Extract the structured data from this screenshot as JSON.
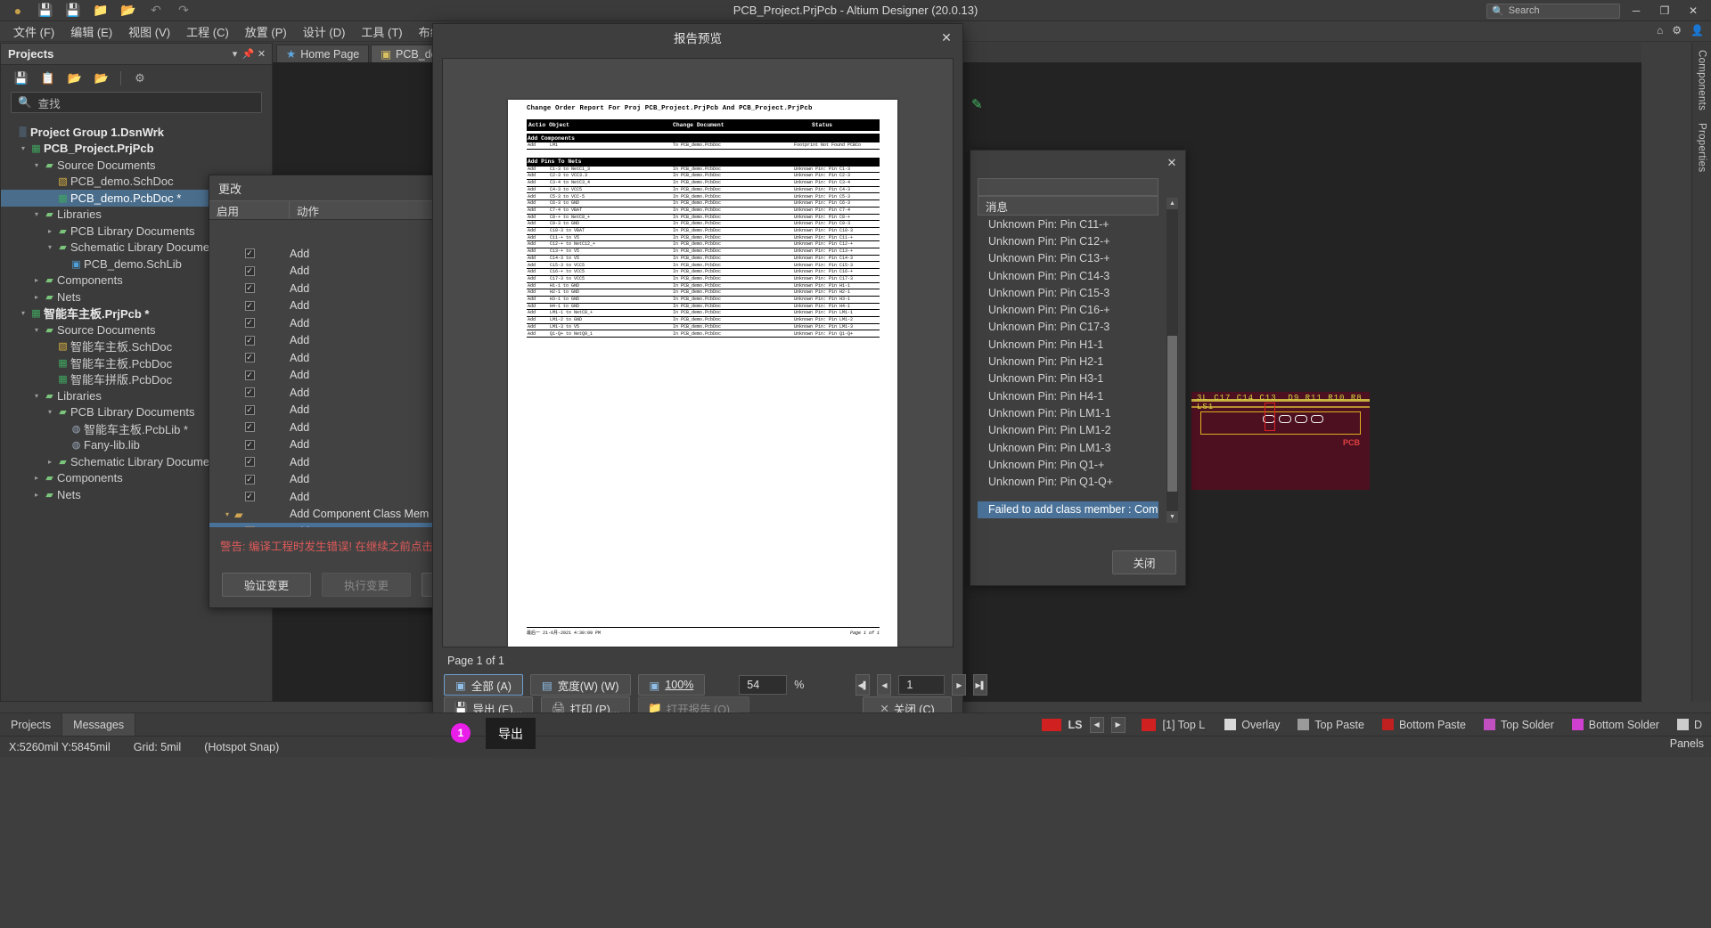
{
  "window": {
    "title": "PCB_Project.PrjPcb - Altium Designer (20.0.13)",
    "search_placeholder": "Search",
    "minimize": "─",
    "maximize": "❐",
    "close": "✕"
  },
  "toolbar_icons": [
    "altium-logo-icon",
    "save-icon",
    "save-all-icon",
    "open-folder-icon",
    "open-project-icon",
    "undo-icon",
    "redo-icon"
  ],
  "menubar": {
    "items": [
      {
        "label": "文件 (F)"
      },
      {
        "label": "编辑 (E)"
      },
      {
        "label": "视图 (V)"
      },
      {
        "label": "工程 (C)"
      },
      {
        "label": "放置 (P)"
      },
      {
        "label": "设计 (D)"
      },
      {
        "label": "工具 (T)"
      },
      {
        "label": "布线 (U)"
      },
      {
        "label": "报"
      }
    ],
    "right_icons": [
      "home-icon",
      "gear-icon",
      "user-icon"
    ]
  },
  "projects_panel": {
    "title": "Projects",
    "header_buttons": [
      "chevron-down-icon",
      "pin-icon",
      "close-icon"
    ],
    "toolbar_icons": [
      "save-icon",
      "compile-icon",
      "open-project-icon",
      "project-options-icon",
      "gear-icon"
    ],
    "search_placeholder": "查找",
    "tree": [
      {
        "label": "Project Group 1.DsnWrk",
        "depth": 0,
        "twist": "",
        "icon": "workspace-icon",
        "bold": true,
        "selected": false
      },
      {
        "label": "PCB_Project.PrjPcb",
        "depth": 1,
        "twist": "▾",
        "icon": "pcb-project-icon",
        "bold": true,
        "selected": false
      },
      {
        "label": "Source Documents",
        "depth": 2,
        "twist": "▾",
        "icon": "folder-icon",
        "bold": false,
        "selected": false
      },
      {
        "label": "PCB_demo.SchDoc",
        "depth": 3,
        "twist": "",
        "icon": "schdoc-icon",
        "bold": false,
        "selected": false
      },
      {
        "label": "PCB_demo.PcbDoc *",
        "depth": 3,
        "twist": "",
        "icon": "pcbdoc-icon",
        "bold": false,
        "selected": true
      },
      {
        "label": "Libraries",
        "depth": 2,
        "twist": "▾",
        "icon": "folder-icon",
        "bold": false,
        "selected": false
      },
      {
        "label": "PCB Library Documents",
        "depth": 3,
        "twist": "▸",
        "icon": "folder-icon",
        "bold": false,
        "selected": false
      },
      {
        "label": "Schematic Library Documents",
        "depth": 3,
        "twist": "▾",
        "icon": "folder-icon",
        "bold": false,
        "selected": false
      },
      {
        "label": "PCB_demo.SchLib",
        "depth": 4,
        "twist": "",
        "icon": "schlib-icon",
        "bold": false,
        "selected": false
      },
      {
        "label": "Components",
        "depth": 2,
        "twist": "▸",
        "icon": "folder-icon",
        "bold": false,
        "selected": false
      },
      {
        "label": "Nets",
        "depth": 2,
        "twist": "▸",
        "icon": "folder-icon",
        "bold": false,
        "selected": false
      },
      {
        "label": "智能车主板.PrjPcb *",
        "depth": 1,
        "twist": "▾",
        "icon": "pcb-project-icon",
        "bold": true,
        "selected": false
      },
      {
        "label": "Source Documents",
        "depth": 2,
        "twist": "▾",
        "icon": "folder-icon",
        "bold": false,
        "selected": false
      },
      {
        "label": "智能车主板.SchDoc",
        "depth": 3,
        "twist": "",
        "icon": "schdoc-icon",
        "bold": false,
        "selected": false
      },
      {
        "label": "智能车主板.PcbDoc",
        "depth": 3,
        "twist": "",
        "icon": "pcbdoc-icon",
        "bold": false,
        "selected": false
      },
      {
        "label": "智能车拼版.PcbDoc",
        "depth": 3,
        "twist": "",
        "icon": "pcbdoc-icon",
        "bold": false,
        "selected": false
      },
      {
        "label": "Libraries",
        "depth": 2,
        "twist": "▾",
        "icon": "folder-icon",
        "bold": false,
        "selected": false
      },
      {
        "label": "PCB Library Documents",
        "depth": 3,
        "twist": "▾",
        "icon": "folder-icon",
        "bold": false,
        "selected": false
      },
      {
        "label": "智能车主板.PcbLib *",
        "depth": 4,
        "twist": "",
        "icon": "pcblib-icon",
        "bold": false,
        "selected": false
      },
      {
        "label": "Fany-lib.lib",
        "depth": 4,
        "twist": "",
        "icon": "pcblib-icon",
        "bold": false,
        "selected": false
      },
      {
        "label": "Schematic Library Documents",
        "depth": 3,
        "twist": "▸",
        "icon": "folder-icon",
        "bold": false,
        "selected": false
      },
      {
        "label": "Components",
        "depth": 2,
        "twist": "▸",
        "icon": "folder-icon",
        "bold": false,
        "selected": false
      },
      {
        "label": "Nets",
        "depth": 2,
        "twist": "▸",
        "icon": "folder-icon",
        "bold": false,
        "selected": false
      }
    ]
  },
  "doc_tabs": [
    {
      "label": "Home Page",
      "icon": "home-icon",
      "active": false
    },
    {
      "label": "PCB_demo.Sch",
      "icon": "schdoc-icon",
      "active": true
    }
  ],
  "right_strip": {
    "items": [
      "Components",
      "Properties"
    ]
  },
  "eco_dialog": {
    "title": "更改",
    "columns": [
      "启用",
      "动作"
    ],
    "rows": [
      {
        "checked": true,
        "action": "Add"
      },
      {
        "checked": true,
        "action": "Add"
      },
      {
        "checked": true,
        "action": "Add"
      },
      {
        "checked": true,
        "action": "Add"
      },
      {
        "checked": true,
        "action": "Add"
      },
      {
        "checked": true,
        "action": "Add"
      },
      {
        "checked": true,
        "action": "Add"
      },
      {
        "checked": true,
        "action": "Add"
      },
      {
        "checked": true,
        "action": "Add"
      },
      {
        "checked": true,
        "action": "Add"
      },
      {
        "checked": true,
        "action": "Add"
      },
      {
        "checked": true,
        "action": "Add"
      },
      {
        "checked": true,
        "action": "Add"
      },
      {
        "checked": true,
        "action": "Add"
      },
      {
        "checked": true,
        "action": "Add"
      }
    ],
    "group_row": {
      "action": "Add Component Class Mem",
      "icon": "folder-icon"
    },
    "selected_row": {
      "checked": false,
      "action": "Add"
    },
    "warning": "警告: 编译工程时发生错误! 在继续之前点击此",
    "buttons": [
      {
        "label": "验证变更",
        "disabled": false
      },
      {
        "label": "执行变更",
        "disabled": true
      },
      {
        "label": "",
        "disabled": false
      }
    ]
  },
  "messages_dialog": {
    "column_header": "消息",
    "close_label": "关闭",
    "items": [
      "Unknown Pin: Pin C11-+",
      "Unknown Pin: Pin C12-+",
      "Unknown Pin: Pin C13-+",
      "Unknown Pin: Pin C14-3",
      "Unknown Pin: Pin C15-3",
      "Unknown Pin: Pin C16-+",
      "Unknown Pin: Pin C17-3",
      "Unknown Pin: Pin H1-1",
      "Unknown Pin: Pin H2-1",
      "Unknown Pin: Pin H3-1",
      "Unknown Pin: Pin H4-1",
      "Unknown Pin: Pin LM1-1",
      "Unknown Pin: Pin LM1-2",
      "Unknown Pin: Pin LM1-3",
      "Unknown Pin: Pin Q1-+",
      "Unknown Pin: Pin Q1-Q+"
    ],
    "selected_item": "Failed to add class member : Component"
  },
  "report_preview": {
    "title": "报告预览",
    "close_icon": "close-icon",
    "page_label": "Page 1 of 1",
    "zoom_buttons": [
      {
        "label": "全部 (A)",
        "icon": "fit-page-icon",
        "active": true
      },
      {
        "label": "宽度(W) (W)",
        "icon": "fit-width-icon",
        "active": false
      },
      {
        "label": "100%",
        "icon": "zoom-100-icon",
        "active": false
      }
    ],
    "zoom_value": "54",
    "zoom_unit": "%",
    "page_number": "1",
    "nav_first": "⏮",
    "nav_prev": "◀",
    "nav_next": "▶",
    "nav_last": "⏭",
    "buttons": [
      {
        "label": "导出 (E)...",
        "icon": "export-icon",
        "disabled": false
      },
      {
        "label": "打印 (P)...",
        "icon": "print-icon",
        "disabled": false
      },
      {
        "label": "打开报告 (O)...",
        "icon": "open-report-icon",
        "disabled": true
      }
    ],
    "close_button": "关闭 (C)",
    "document": {
      "title": "Change Order Report For Proj PCB_Project.PrjPcb And PCB_Project.PrjPcb",
      "header": {
        "action_object": "Actio Object",
        "change_document": "Change Document",
        "status": "Status"
      },
      "sections": [
        {
          "name": "Add Components",
          "rows": [
            {
              "action": "Add",
              "object": "LM1",
              "document": "To PCB_demo.PcbDoc",
              "status": "Footprint Not Found PCBCo"
            }
          ]
        },
        {
          "name": "Add Pins To Nets",
          "rows": [
            {
              "action": "Add",
              "object": "C1-3 to NetC1_3",
              "document": "In PCB_demo.PcbDoc",
              "status": "Unknown Pin: Pin C1-3"
            },
            {
              "action": "Add",
              "object": "C2-3 to VCC3.3",
              "document": "In PCB_demo.PcbDoc",
              "status": "Unknown Pin: Pin C2-3"
            },
            {
              "action": "Add",
              "object": "C3-4 to NetC3_4",
              "document": "In PCB_demo.PcbDoc",
              "status": "Unknown Pin: Pin C3-4"
            },
            {
              "action": "Add",
              "object": "C4-3 to VCC5",
              "document": "In PCB_demo.PcbDoc",
              "status": "Unknown Pin: Pin C4-3"
            },
            {
              "action": "Add",
              "object": "C5-3 to VCC-5",
              "document": "In PCB_demo.PcbDoc",
              "status": "Unknown Pin: Pin C5-3"
            },
            {
              "action": "Add",
              "object": "C6-3 to GND",
              "document": "In PCB_demo.PcbDoc",
              "status": "Unknown Pin: Pin C6-3"
            },
            {
              "action": "Add",
              "object": "C7-4 to VBAT",
              "document": "In PCB_demo.PcbDoc",
              "status": "Unknown Pin: Pin C7-4"
            },
            {
              "action": "Add",
              "object": "C8-+ to NetC8_+",
              "document": "In PCB_demo.PcbDoc",
              "status": "Unknown Pin: Pin C8-+"
            },
            {
              "action": "Add",
              "object": "C9-3 to GND",
              "document": "In PCB_demo.PcbDoc",
              "status": "Unknown Pin: Pin C9-3"
            },
            {
              "action": "Add",
              "object": "C10-3 to VBAT",
              "document": "In PCB_demo.PcbDoc",
              "status": "Unknown Pin: Pin C10-3"
            },
            {
              "action": "Add",
              "object": "C11-+ to V5",
              "document": "In PCB_demo.PcbDoc",
              "status": "Unknown Pin: Pin C11-+"
            },
            {
              "action": "Add",
              "object": "C12-+ to NetC12_+",
              "document": "In PCB_demo.PcbDoc",
              "status": "Unknown Pin: Pin C12-+"
            },
            {
              "action": "Add",
              "object": "C13-+ to V5",
              "document": "In PCB_demo.PcbDoc",
              "status": "Unknown Pin: Pin C13-+"
            },
            {
              "action": "Add",
              "object": "C14-3 to V5",
              "document": "In PCB_demo.PcbDoc",
              "status": "Unknown Pin: Pin C14-3"
            },
            {
              "action": "Add",
              "object": "C15-3 to VCC5",
              "document": "In PCB_demo.PcbDoc",
              "status": "Unknown Pin: Pin C15-3"
            },
            {
              "action": "Add",
              "object": "C16-+ to VCC5",
              "document": "In PCB_demo.PcbDoc",
              "status": "Unknown Pin: Pin C16-+"
            },
            {
              "action": "Add",
              "object": "C17-3 to VCC5",
              "document": "In PCB_demo.PcbDoc",
              "status": "Unknown Pin: Pin C17-3"
            },
            {
              "action": "Add",
              "object": "H1-1 to GND",
              "document": "In PCB_demo.PcbDoc",
              "status": "Unknown Pin: Pin H1-1"
            },
            {
              "action": "Add",
              "object": "H2-1 to GND",
              "document": "In PCB_demo.PcbDoc",
              "status": "Unknown Pin: Pin H2-1"
            },
            {
              "action": "Add",
              "object": "H3-1 to GND",
              "document": "In PCB_demo.PcbDoc",
              "status": "Unknown Pin: Pin H3-1"
            },
            {
              "action": "Add",
              "object": "H4-1 to GND",
              "document": "In PCB_demo.PcbDoc",
              "status": "Unknown Pin: Pin H4-1"
            },
            {
              "action": "Add",
              "object": "LM1-1 to NetC8_+",
              "document": "In PCB_demo.PcbDoc",
              "status": "Unknown Pin: Pin LM1-1"
            },
            {
              "action": "Add",
              "object": "LM1-2 to GND",
              "document": "In PCB_demo.PcbDoc",
              "status": "Unknown Pin: Pin LM1-2"
            },
            {
              "action": "Add",
              "object": "LM1-3 to V5",
              "document": "In PCB_demo.PcbDoc",
              "status": "Unknown Pin: Pin LM1-3"
            },
            {
              "action": "Add",
              "object": "Q1-Q+ to NetQ9_1",
              "document": "In PCB_demo.PcbDoc",
              "status": "Unknown Pin: Pin Q1-Q+"
            }
          ]
        }
      ],
      "footer_left": "最后一 21-6月-2021   4:30:09 PM",
      "footer_right": "Page 1 of 1"
    }
  },
  "callout": {
    "badge": "1",
    "text": "导出"
  },
  "bottom_tabs": [
    {
      "label": "Projects",
      "active": false
    },
    {
      "label": "Messages",
      "active": true
    }
  ],
  "layer_bar": {
    "ls_label": "LS",
    "layer_tab": "[1] Top L",
    "nav_prev": "◀",
    "nav_next": "▶",
    "chips": [
      {
        "label": "Overlay",
        "color": "#d8d8d8",
        "swatch": false
      },
      {
        "label": "Top Paste",
        "color": "#9a9a9a",
        "swatch": true
      },
      {
        "label": "Bottom Paste",
        "color": "#c02020",
        "swatch": true
      },
      {
        "label": "Top Solder",
        "color": "#c050c0",
        "swatch": true
      },
      {
        "label": "Bottom Solder",
        "color": "#d040d0",
        "swatch": true
      },
      {
        "label": "D",
        "color": "#cccccc",
        "swatch": true
      }
    ],
    "left_swatch_color": "#d02020"
  },
  "statusbar": {
    "coords": "X:5260mil Y:5845mil",
    "grid": "Grid: 5mil",
    "snap": "(Hotspot Snap)",
    "panels": "Panels"
  }
}
